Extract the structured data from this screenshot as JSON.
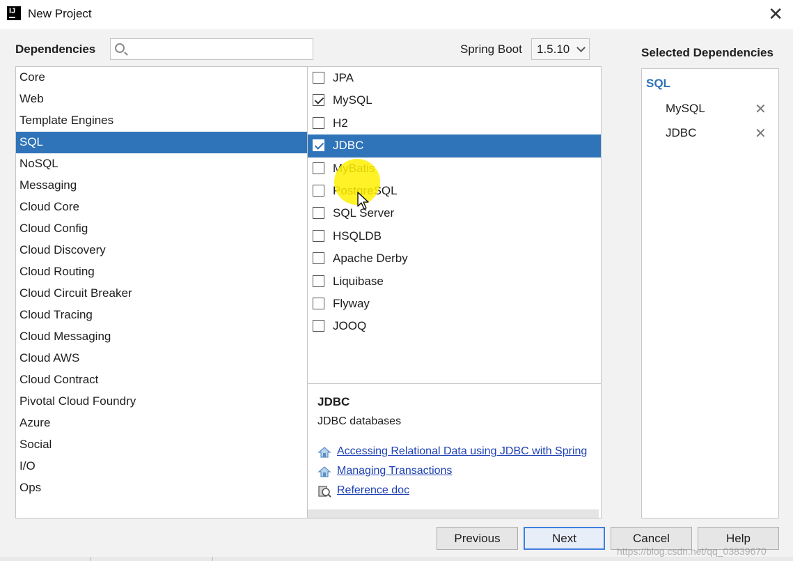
{
  "window": {
    "title": "New Project",
    "app_icon_text": "IJ"
  },
  "header": {
    "dependencies_label": "Dependencies",
    "search": {
      "value": "",
      "placeholder": ""
    },
    "spring_boot_label": "Spring Boot",
    "spring_boot_version": "1.5.10"
  },
  "categories": [
    {
      "label": "Core",
      "selected": false
    },
    {
      "label": "Web",
      "selected": false
    },
    {
      "label": "Template Engines",
      "selected": false
    },
    {
      "label": "SQL",
      "selected": true
    },
    {
      "label": "NoSQL",
      "selected": false
    },
    {
      "label": "Messaging",
      "selected": false
    },
    {
      "label": "Cloud Core",
      "selected": false
    },
    {
      "label": "Cloud Config",
      "selected": false
    },
    {
      "label": "Cloud Discovery",
      "selected": false
    },
    {
      "label": "Cloud Routing",
      "selected": false
    },
    {
      "label": "Cloud Circuit Breaker",
      "selected": false
    },
    {
      "label": "Cloud Tracing",
      "selected": false
    },
    {
      "label": "Cloud Messaging",
      "selected": false
    },
    {
      "label": "Cloud AWS",
      "selected": false
    },
    {
      "label": "Cloud Contract",
      "selected": false
    },
    {
      "label": "Pivotal Cloud Foundry",
      "selected": false
    },
    {
      "label": "Azure",
      "selected": false
    },
    {
      "label": "Social",
      "selected": false
    },
    {
      "label": "I/O",
      "selected": false
    },
    {
      "label": "Ops",
      "selected": false
    }
  ],
  "dependencies": [
    {
      "label": "JPA",
      "checked": false,
      "selected": false
    },
    {
      "label": "MySQL",
      "checked": true,
      "selected": false
    },
    {
      "label": "H2",
      "checked": false,
      "selected": false
    },
    {
      "label": "JDBC",
      "checked": true,
      "selected": true
    },
    {
      "label": "MyBatis",
      "checked": false,
      "selected": false
    },
    {
      "label": "PostgreSQL",
      "checked": false,
      "selected": false
    },
    {
      "label": "SQL Server",
      "checked": false,
      "selected": false
    },
    {
      "label": "HSQLDB",
      "checked": false,
      "selected": false
    },
    {
      "label": "Apache Derby",
      "checked": false,
      "selected": false
    },
    {
      "label": "Liquibase",
      "checked": false,
      "selected": false
    },
    {
      "label": "Flyway",
      "checked": false,
      "selected": false
    },
    {
      "label": "JOOQ",
      "checked": false,
      "selected": false
    }
  ],
  "description": {
    "title": "JDBC",
    "text": "JDBC databases",
    "links": [
      {
        "label": "Accessing Relational Data using JDBC with Spring",
        "icon": "guide-icon"
      },
      {
        "label": "Managing Transactions",
        "icon": "guide-icon"
      },
      {
        "label": "Reference doc",
        "icon": "reference-doc-icon"
      }
    ]
  },
  "selected_panel": {
    "title": "Selected Dependencies",
    "group": "SQL",
    "items": [
      {
        "label": "MySQL"
      },
      {
        "label": "JDBC"
      }
    ],
    "remove_glyph": "✕"
  },
  "buttons": {
    "previous": "Previous",
    "next": "Next",
    "cancel": "Cancel",
    "help": "Help"
  },
  "close_glyph": "✕",
  "watermark": "https://blog.csdn.net/qq_03839670",
  "colors": {
    "selection": "#2f73b8",
    "link": "#1d3fb3",
    "cursor_highlight": "#fff000",
    "primary_border": "#3f7ee0"
  }
}
